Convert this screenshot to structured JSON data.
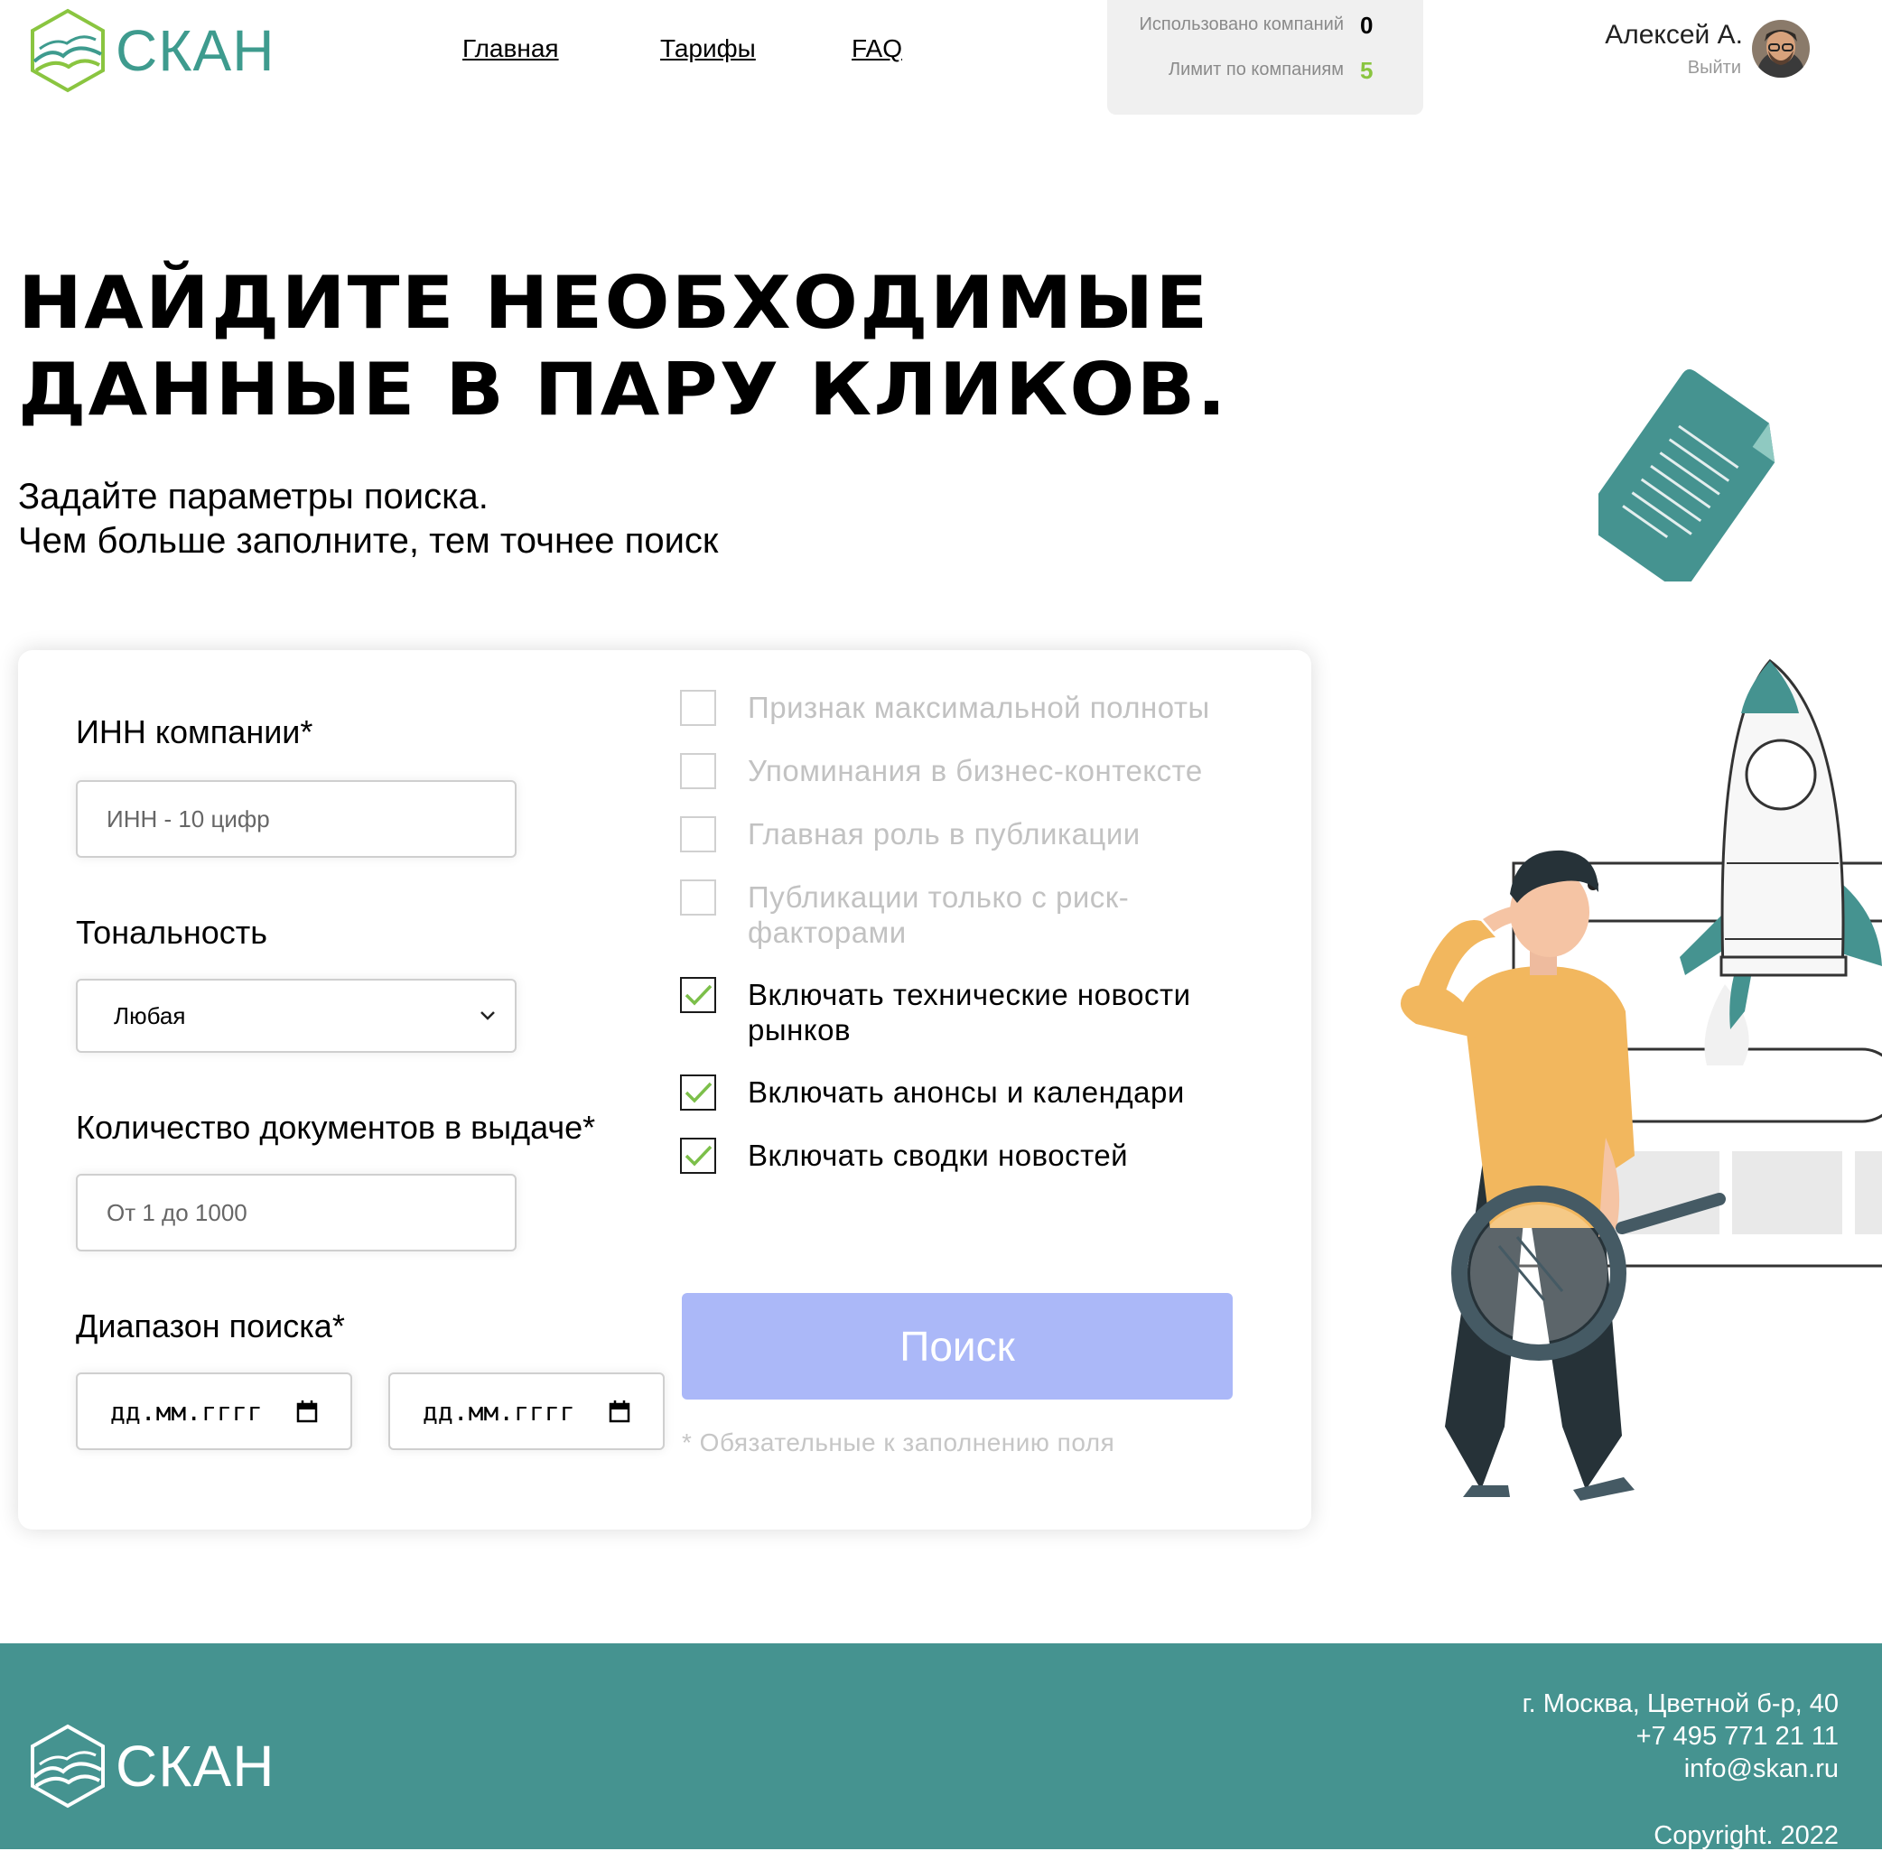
{
  "brand": {
    "name": "СКАН"
  },
  "nav": {
    "items": [
      "Главная",
      "Тарифы",
      "FAQ"
    ]
  },
  "stats": {
    "used_label": "Использовано компаний",
    "used_value": "0",
    "limit_label": "Лимит по компаниям",
    "limit_value": "5",
    "limit_color": "#8ac540"
  },
  "user": {
    "name": "Алексей А.",
    "logout": "Выйти"
  },
  "hero": {
    "title_line1": "НАЙДИТЕ НЕОБХОДИМЫЕ",
    "title_line2": "ДАННЫЕ В ПАРУ КЛИКОВ.",
    "subtitle_line1": "Задайте параметры поиска.",
    "subtitle_line2": "Чем больше заполните, тем точнее поиск"
  },
  "form": {
    "inn": {
      "label": "ИНН компании*",
      "placeholder": "ИНН - 10 цифр"
    },
    "tone": {
      "label": "Тональность",
      "value": "Любая"
    },
    "docs": {
      "label": "Количество документов в выдаче*",
      "placeholder": "От 1 до 1000"
    },
    "range": {
      "label": "Диапазон поиска*",
      "start_placeholder": "дд.мм.гггг",
      "end_placeholder": "дд.мм.гггг"
    },
    "checkboxes": [
      {
        "label": "Признак максимальной полноты",
        "checked": false
      },
      {
        "label": "Упоминания в бизнес-контексте",
        "checked": false
      },
      {
        "label": "Главная роль в публикации",
        "checked": false
      },
      {
        "label": "Публикации только с риск-факторами",
        "checked": false
      },
      {
        "label": "Включать технические новости рынков",
        "checked": true
      },
      {
        "label": "Включать анонсы и календари",
        "checked": true
      },
      {
        "label": "Включать сводки новостей",
        "checked": true
      }
    ],
    "submit": "Поиск",
    "required_note": "* Обязательные к заполнению поля"
  },
  "footer": {
    "address": "г. Москва, Цветной б-р, 40",
    "phone": "+7 495 771 21 11",
    "email": "info@skan.ru",
    "copyright": "Copyright. 2022"
  },
  "colors": {
    "brand_teal": "#459390",
    "button_disabled": "#abb8f8",
    "check_green": "#7cbf4a",
    "shirt_yellow": "#f2b75e"
  },
  "icons": [
    "skan-logo-icon",
    "calendar-icon",
    "chevron-down-icon",
    "checkmark-icon",
    "avatar",
    "document-illustration",
    "rocket-illustration",
    "man-with-magnifier-illustration"
  ]
}
